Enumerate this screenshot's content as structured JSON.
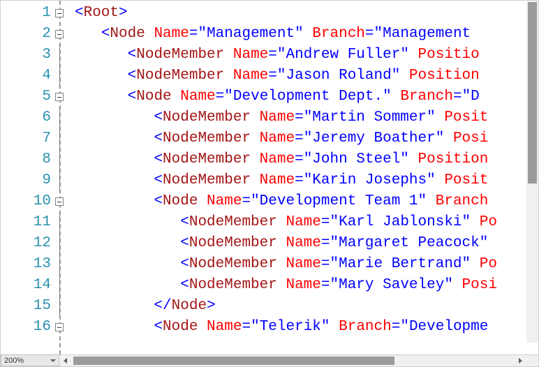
{
  "zoom": {
    "label": "200%"
  },
  "lines": [
    {
      "n": 1,
      "fold": true,
      "indent": 0,
      "tokens": [
        [
          "punct",
          "<"
        ],
        [
          "elem",
          "Root"
        ],
        [
          "punct",
          ">"
        ]
      ]
    },
    {
      "n": 2,
      "fold": true,
      "indent": 1,
      "tokens": [
        [
          "punct",
          "<"
        ],
        [
          "elem",
          "Node "
        ],
        [
          "attr",
          "Name"
        ],
        [
          "eq",
          "="
        ],
        [
          "str",
          "\"Management\" "
        ],
        [
          "attr",
          "Branch"
        ],
        [
          "eq",
          "="
        ],
        [
          "str",
          "\"Management"
        ]
      ]
    },
    {
      "n": 3,
      "fold": false,
      "indent": 2,
      "tokens": [
        [
          "punct",
          "<"
        ],
        [
          "elem",
          "NodeMember "
        ],
        [
          "attr",
          "Name"
        ],
        [
          "eq",
          "="
        ],
        [
          "str",
          "\"Andrew Fuller\" "
        ],
        [
          "attr",
          "Positio"
        ]
      ]
    },
    {
      "n": 4,
      "fold": false,
      "indent": 2,
      "tokens": [
        [
          "punct",
          "<"
        ],
        [
          "elem",
          "NodeMember "
        ],
        [
          "attr",
          "Name"
        ],
        [
          "eq",
          "="
        ],
        [
          "str",
          "\"Jason Roland\" "
        ],
        [
          "attr",
          "Position"
        ]
      ]
    },
    {
      "n": 5,
      "fold": true,
      "indent": 2,
      "tokens": [
        [
          "punct",
          "<"
        ],
        [
          "elem",
          "Node "
        ],
        [
          "attr",
          "Name"
        ],
        [
          "eq",
          "="
        ],
        [
          "str",
          "\"Development Dept.\" "
        ],
        [
          "attr",
          "Branch"
        ],
        [
          "eq",
          "="
        ],
        [
          "str",
          "\"D"
        ]
      ]
    },
    {
      "n": 6,
      "fold": false,
      "indent": 3,
      "tokens": [
        [
          "punct",
          "<"
        ],
        [
          "elem",
          "NodeMember "
        ],
        [
          "attr",
          "Name"
        ],
        [
          "eq",
          "="
        ],
        [
          "str",
          "\"Martin Sommer\" "
        ],
        [
          "attr",
          "Posit"
        ]
      ]
    },
    {
      "n": 7,
      "fold": false,
      "indent": 3,
      "tokens": [
        [
          "punct",
          "<"
        ],
        [
          "elem",
          "NodeMember "
        ],
        [
          "attr",
          "Name"
        ],
        [
          "eq",
          "="
        ],
        [
          "str",
          "\"Jeremy Boather\" "
        ],
        [
          "attr",
          "Posi"
        ]
      ]
    },
    {
      "n": 8,
      "fold": false,
      "indent": 3,
      "tokens": [
        [
          "punct",
          "<"
        ],
        [
          "elem",
          "NodeMember "
        ],
        [
          "attr",
          "Name"
        ],
        [
          "eq",
          "="
        ],
        [
          "str",
          "\"John Steel\" "
        ],
        [
          "attr",
          "Position"
        ]
      ]
    },
    {
      "n": 9,
      "fold": false,
      "indent": 3,
      "tokens": [
        [
          "punct",
          "<"
        ],
        [
          "elem",
          "NodeMember "
        ],
        [
          "attr",
          "Name"
        ],
        [
          "eq",
          "="
        ],
        [
          "str",
          "\"Karin Josephs\" "
        ],
        [
          "attr",
          "Posit"
        ]
      ]
    },
    {
      "n": 10,
      "fold": true,
      "indent": 3,
      "tokens": [
        [
          "punct",
          "<"
        ],
        [
          "elem",
          "Node "
        ],
        [
          "attr",
          "Name"
        ],
        [
          "eq",
          "="
        ],
        [
          "str",
          "\"Development Team 1\" "
        ],
        [
          "attr",
          "Branch"
        ]
      ]
    },
    {
      "n": 11,
      "fold": false,
      "indent": 4,
      "tokens": [
        [
          "punct",
          "<"
        ],
        [
          "elem",
          "NodeMember "
        ],
        [
          "attr",
          "Name"
        ],
        [
          "eq",
          "="
        ],
        [
          "str",
          "\"Karl Jablonski\" "
        ],
        [
          "attr",
          "Po"
        ]
      ]
    },
    {
      "n": 12,
      "fold": false,
      "indent": 4,
      "tokens": [
        [
          "punct",
          "<"
        ],
        [
          "elem",
          "NodeMember "
        ],
        [
          "attr",
          "Name"
        ],
        [
          "eq",
          "="
        ],
        [
          "str",
          "\"Margaret Peacock\" "
        ]
      ]
    },
    {
      "n": 13,
      "fold": false,
      "indent": 4,
      "tokens": [
        [
          "punct",
          "<"
        ],
        [
          "elem",
          "NodeMember "
        ],
        [
          "attr",
          "Name"
        ],
        [
          "eq",
          "="
        ],
        [
          "str",
          "\"Marie Bertrand\" "
        ],
        [
          "attr",
          "Po"
        ]
      ]
    },
    {
      "n": 14,
      "fold": false,
      "indent": 4,
      "tokens": [
        [
          "punct",
          "<"
        ],
        [
          "elem",
          "NodeMember "
        ],
        [
          "attr",
          "Name"
        ],
        [
          "eq",
          "="
        ],
        [
          "str",
          "\"Mary Saveley\" "
        ],
        [
          "attr",
          "Posi"
        ]
      ]
    },
    {
      "n": 15,
      "fold": false,
      "indent": 3,
      "tokens": [
        [
          "punct",
          "</"
        ],
        [
          "elem",
          "Node"
        ],
        [
          "punct",
          ">"
        ]
      ]
    },
    {
      "n": 16,
      "fold": true,
      "indent": 3,
      "tokens": [
        [
          "punct",
          "<"
        ],
        [
          "elem",
          "Node "
        ],
        [
          "attr",
          "Name"
        ],
        [
          "eq",
          "="
        ],
        [
          "str",
          "\"Telerik\" "
        ],
        [
          "attr",
          "Branch"
        ],
        [
          "eq",
          "="
        ],
        [
          "str",
          "\"Developme"
        ]
      ]
    }
  ]
}
